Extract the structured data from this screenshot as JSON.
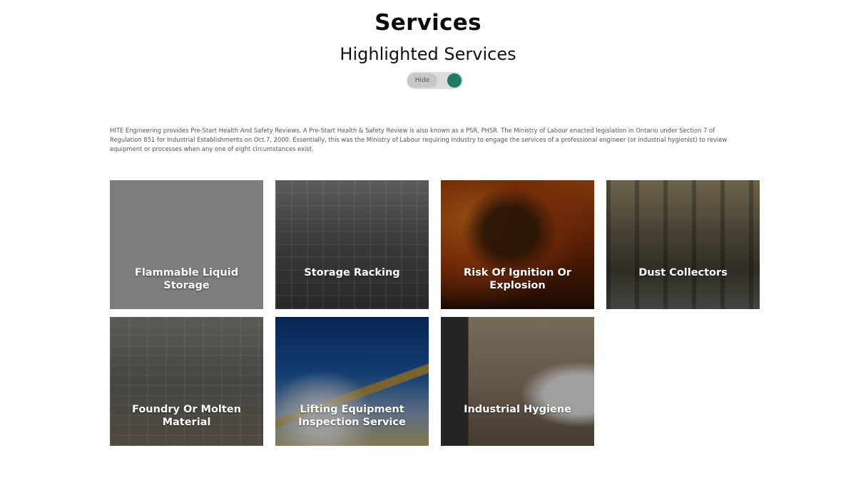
{
  "header": {
    "title": "Services",
    "subtitle": "Highlighted Services",
    "toggle_label": "Hide"
  },
  "intro": {
    "text": "HITE Engineering provides Pre-Start Health And Safety Reviews. A Pre-Start Health & Safety Review is also known as a PSR, PHSR. The Ministry of Labour enacted legislation in Ontario under Section 7 of Regulation 851 for Industrial Establishments on Oct.7, 2000. Essentially, this was the Ministry of Labour requiring industry to engage the services of a professional engineer (or industrial hygienist) to review equipment or processes when any one of eight circumstances exist."
  },
  "services": [
    {
      "label": "Flammable Liquid Storage"
    },
    {
      "label": "Storage Racking"
    },
    {
      "label": "Risk Of Ignition Or Explosion"
    },
    {
      "label": "Dust Collectors"
    },
    {
      "label": "Foundry Or Molten Material"
    },
    {
      "label": "Lifting Equipment Inspection Service"
    },
    {
      "label": "Industrial Hygiene"
    }
  ],
  "colors": {
    "toggle_on": "#1f7a66",
    "card_placeholder": "#7d7d7d"
  }
}
